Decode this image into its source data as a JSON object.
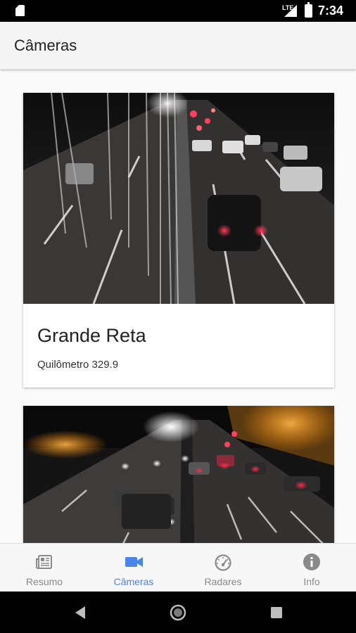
{
  "status_bar": {
    "network_label": "LTE",
    "time": "7:34",
    "icons": [
      "sd-card-icon",
      "signal-icon",
      "battery-icon"
    ]
  },
  "app_bar": {
    "title": "Câmeras"
  },
  "cameras": [
    {
      "name": "Grande Reta",
      "location": "Quilômetro 329.9",
      "image": "night-highway-traffic-camera"
    },
    {
      "name": "",
      "location": "",
      "image": "night-highway-traffic-camera"
    }
  ],
  "bottom_nav": {
    "active_color": "#4a86e8",
    "inactive_color": "#888888",
    "items": [
      {
        "label": "Resumo",
        "icon": "newspaper-icon",
        "active": false
      },
      {
        "label": "Câmeras",
        "icon": "videocam-icon",
        "active": true
      },
      {
        "label": "Radares",
        "icon": "speedometer-icon",
        "active": false
      },
      {
        "label": "Info",
        "icon": "info-icon",
        "active": false
      }
    ]
  },
  "system_nav": {
    "buttons": [
      "back-icon",
      "home-icon",
      "recents-icon"
    ]
  }
}
